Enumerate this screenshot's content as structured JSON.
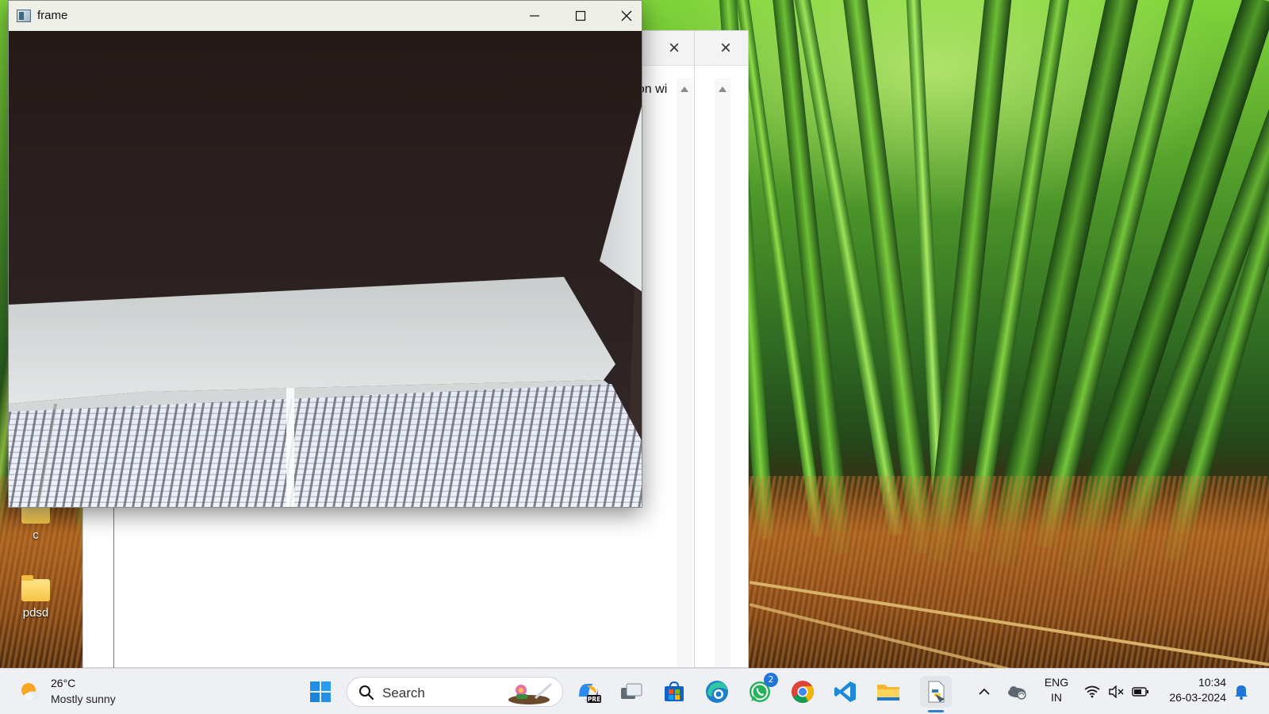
{
  "desktop": {
    "icons": [
      {
        "label": "c",
        "icon": "folder-icon"
      },
      {
        "label": "pdsd",
        "icon": "folder-icon"
      }
    ]
  },
  "background_window": {
    "visible_text": "] on wi"
  },
  "frame_window": {
    "title": "frame",
    "controls": {
      "minimize": "minimize-icon",
      "maximize": "maximize-icon",
      "close": "close-icon"
    }
  },
  "taskbar": {
    "weather": {
      "temperature": "26°C",
      "condition": "Mostly sunny",
      "icon": "partly-sunny-icon"
    },
    "search": {
      "placeholder": "Search"
    },
    "apps": [
      {
        "name": "start-button",
        "icon": "windows-logo-icon"
      },
      {
        "name": "copilot-button",
        "icon": "copilot-pre-icon",
        "badge": "PRE"
      },
      {
        "name": "task-view-button",
        "icon": "task-view-icon"
      },
      {
        "name": "microsoft-store-button",
        "icon": "store-icon"
      },
      {
        "name": "edge-button",
        "icon": "edge-icon"
      },
      {
        "name": "whatsapp-button",
        "icon": "whatsapp-icon",
        "badge": "2"
      },
      {
        "name": "chrome-button",
        "icon": "chrome-icon"
      },
      {
        "name": "vscode-button",
        "icon": "vscode-icon"
      },
      {
        "name": "file-explorer-button",
        "icon": "folder-icon"
      },
      {
        "name": "python-app-button",
        "icon": "python-file-icon",
        "active": true
      }
    ],
    "tray": {
      "language_line1": "ENG",
      "language_line2": "IN",
      "time": "10:34",
      "date": "26-03-2024"
    }
  },
  "colors": {
    "taskbar_bg": "#eef0f4",
    "accent": "#2d7fd3",
    "titlebar_bg": "#eef0e8"
  }
}
